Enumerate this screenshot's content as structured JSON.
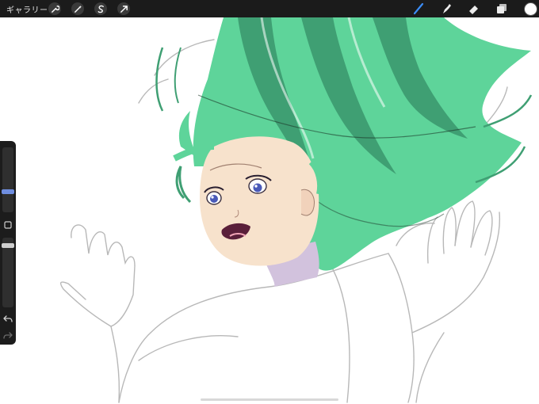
{
  "topbar": {
    "gallery_label": "ギャラリー",
    "left_tools": [
      "wrench-icon",
      "magic-wand-icon",
      "selection-s-icon",
      "transform-arrow-icon"
    ],
    "right_tools": [
      "brush-icon",
      "smudge-icon",
      "eraser-icon",
      "layers-icon"
    ],
    "active_tool": "brush-icon",
    "current_color": "#ffffff",
    "accent_color": "#3b8cf5"
  },
  "sidebar": {
    "brush_size_level": 0.35,
    "opacity_level": 0.1,
    "modify_button": "square-icon",
    "undo_button": "undo-arrow-icon",
    "redo_button": "redo-arrow-icon"
  },
  "artwork": {
    "hair_color": "#5ed49a",
    "hair_shadow": "#3f9f73",
    "skin_color": "#f7e2cc",
    "neck_shadow": "#d2c2dd",
    "eye_color": "#4a5ab8"
  }
}
